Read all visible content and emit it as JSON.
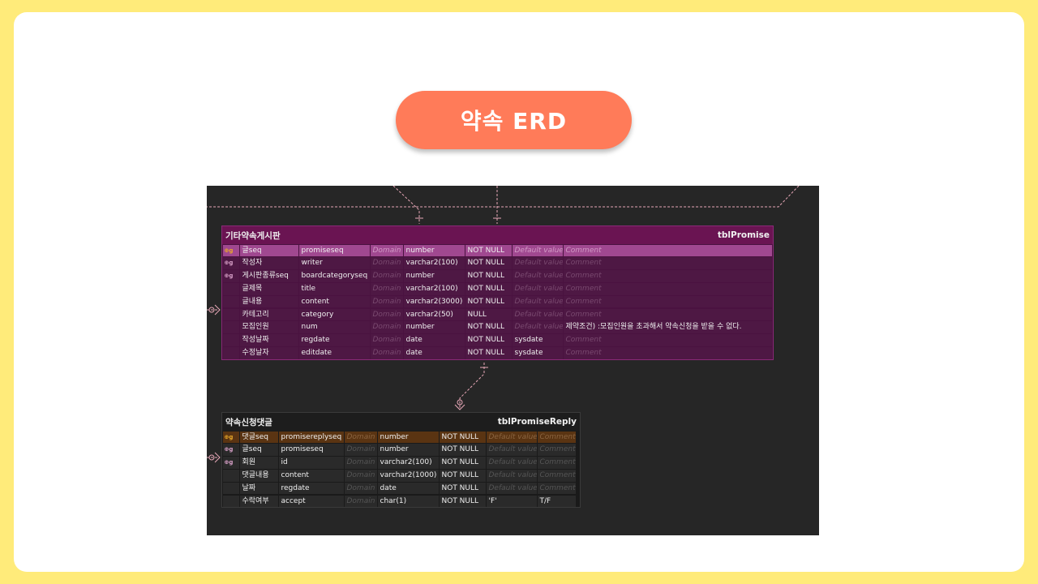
{
  "title": "약속 ERD",
  "key_icon_text": "⊕g",
  "colors": {
    "accent": "#ff7b59",
    "background": "#ffeb7a",
    "canvas": "#262626",
    "promise_table": "#6a1452",
    "reply_table": "#1a1a1a"
  },
  "tables": [
    {
      "logical_name": "기타약속게시판",
      "physical_name": "tblPromise",
      "columns": [
        {
          "key": "pk",
          "logical": "글seq",
          "physical": "promiseseq",
          "domain": "Domain",
          "type": "number",
          "null": "NOT NULL",
          "default": "Default value",
          "default_placeholder": true,
          "comment": "Comment",
          "comment_placeholder": true
        },
        {
          "key": "fk",
          "logical": "작성자",
          "physical": "writer",
          "domain": "Domain",
          "type": "varchar2(100)",
          "null": "NOT NULL",
          "default": "Default value",
          "default_placeholder": true,
          "comment": "Comment",
          "comment_placeholder": true
        },
        {
          "key": "fk",
          "logical": "게시판종류seq",
          "physical": "boardcategoryseq",
          "domain": "Domain",
          "type": "number",
          "null": "NOT NULL",
          "default": "Default value",
          "default_placeholder": true,
          "comment": "Comment",
          "comment_placeholder": true
        },
        {
          "key": "",
          "logical": "글제목",
          "physical": "title",
          "domain": "Domain",
          "type": "varchar2(100)",
          "null": "NOT NULL",
          "default": "Default value",
          "default_placeholder": true,
          "comment": "Comment",
          "comment_placeholder": true
        },
        {
          "key": "",
          "logical": "글내용",
          "physical": "content",
          "domain": "Domain",
          "type": "varchar2(3000)",
          "null": "NOT NULL",
          "default": "Default value",
          "default_placeholder": true,
          "comment": "Comment",
          "comment_placeholder": true
        },
        {
          "key": "",
          "logical": "카테고리",
          "physical": "category",
          "domain": "Domain",
          "type": "varchar2(50)",
          "null": "NULL",
          "default": "Default value",
          "default_placeholder": true,
          "comment": "Comment",
          "comment_placeholder": true
        },
        {
          "key": "",
          "logical": "모집인원",
          "physical": "num",
          "domain": "Domain",
          "type": "number",
          "null": "NOT NULL",
          "default": "Default value",
          "default_placeholder": true,
          "comment": "제약조건) :모집인원을 초과해서 약속신청을 받을 수 없다.",
          "comment_placeholder": false
        },
        {
          "key": "",
          "logical": "작성날짜",
          "physical": "regdate",
          "domain": "Domain",
          "type": "date",
          "null": "NOT NULL",
          "default": "sysdate",
          "default_placeholder": false,
          "comment": "Comment",
          "comment_placeholder": true
        },
        {
          "key": "",
          "logical": "수정날자",
          "physical": "editdate",
          "domain": "Domain",
          "type": "date",
          "null": "NOT NULL",
          "default": "sysdate",
          "default_placeholder": false,
          "comment": "Comment",
          "comment_placeholder": true
        }
      ]
    },
    {
      "logical_name": "약속신청댓글",
      "physical_name": "tblPromiseReply",
      "columns": [
        {
          "key": "pk",
          "logical": "댓글seq",
          "physical": "promisereplyseq",
          "domain": "Domain",
          "type": "number",
          "null": "NOT NULL",
          "default": "Default value",
          "default_placeholder": true,
          "comment": "Comment",
          "comment_placeholder": true
        },
        {
          "key": "fk",
          "logical": "글seq",
          "physical": "promiseseq",
          "domain": "Domain",
          "type": "number",
          "null": "NOT NULL",
          "default": "Default value",
          "default_placeholder": true,
          "comment": "Comment",
          "comment_placeholder": true
        },
        {
          "key": "fk",
          "logical": "회원",
          "physical": "id",
          "domain": "Domain",
          "type": "varchar2(100)",
          "null": "NOT NULL",
          "default": "Default value",
          "default_placeholder": true,
          "comment": "Comment",
          "comment_placeholder": true
        },
        {
          "key": "",
          "logical": "댓글내용",
          "physical": "content",
          "domain": "Domain",
          "type": "varchar2(1000)",
          "null": "NOT NULL",
          "default": "Default value",
          "default_placeholder": true,
          "comment": "Comment",
          "comment_placeholder": true
        },
        {
          "key": "",
          "logical": "날짜",
          "physical": "regdate",
          "domain": "Domain",
          "type": "date",
          "null": "NOT NULL",
          "default": "Default value",
          "default_placeholder": true,
          "comment": "Comment",
          "comment_placeholder": true
        },
        {
          "key": "",
          "logical": "수락여부",
          "physical": "accept",
          "domain": "Domain",
          "type": "char(1)",
          "null": "NOT NULL",
          "default": "'F'",
          "default_placeholder": false,
          "comment": "T/F",
          "comment_placeholder": false
        }
      ]
    }
  ]
}
